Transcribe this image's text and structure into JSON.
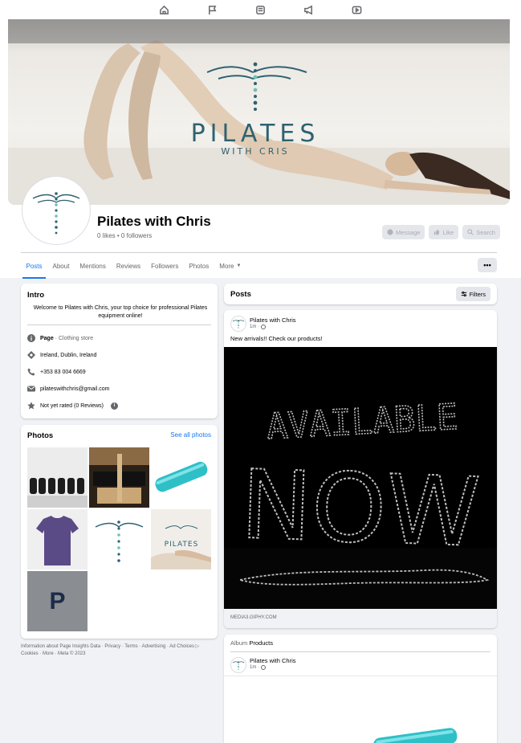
{
  "topnav": {
    "icons": [
      "home-icon",
      "flag-icon",
      "marketplace-icon",
      "megaphone-icon",
      "watch-icon"
    ]
  },
  "page": {
    "cover_brand_top": "PILATES",
    "cover_brand_bottom": "WITH CRIS",
    "name": "Pilates with Chris",
    "stats": "0 likes • 0 followers"
  },
  "actions": {
    "message": "Message",
    "like": "Like",
    "search": "Search"
  },
  "tabs": [
    {
      "label": "Posts"
    },
    {
      "label": "About"
    },
    {
      "label": "Mentions"
    },
    {
      "label": "Reviews"
    },
    {
      "label": "Followers"
    },
    {
      "label": "Photos"
    },
    {
      "label": "More"
    }
  ],
  "more_menu": "•••",
  "intro": {
    "title": "Intro",
    "bio": "Welcome to Pilates with Chris, your top choice for professional Pilates equipment online!",
    "page_label": "Page",
    "category": " · Clothing store",
    "location": "Ireland, Dublin, Ireland",
    "phone": "+353 83 004 6669",
    "email": "pilateswithchris@gmail.com",
    "rating": "Not yet rated (0 Reviews)",
    "info_mark": "i"
  },
  "photos": {
    "title": "Photos",
    "see_all": "See all photos",
    "placeholder_letter": "P"
  },
  "footer": {
    "line1": "Information about Page Insights Data · Privacy · Terms · Advertising · Ad Choices ▷",
    "line2": "Cookies · More · Meta © 2023"
  },
  "posts": {
    "title": "Posts",
    "filters": "Filters",
    "post1": {
      "author": "Pilates with Chris",
      "time": "1m ·",
      "text": "New arrivals!! Check our products!",
      "gif_line1": "AVAILABLE",
      "gif_line2": "NOW",
      "link_domain": "MEDIA3.GIPHY.COM"
    },
    "post2": {
      "album_prefix": "Album",
      "album_name": "Products",
      "author": "Pilates with Chris",
      "time": "1m ·"
    }
  },
  "colors": {
    "accent": "#1877f2",
    "brand_teal": "#3a6f7a",
    "background": "#f0f2f5"
  }
}
